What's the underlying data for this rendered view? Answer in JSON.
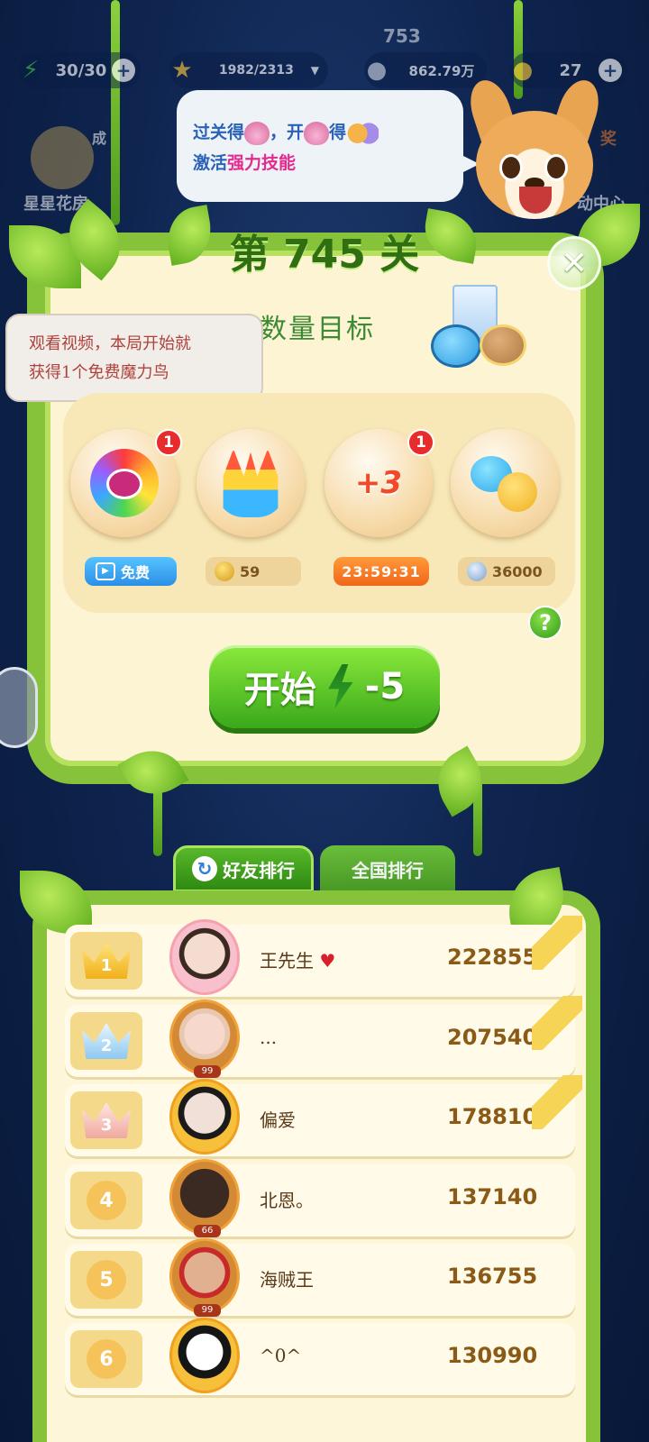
{
  "hud": {
    "energy": "30/30",
    "stars": "1982/2313",
    "coins": "862.79万",
    "gold": "27",
    "level_top": "753"
  },
  "background": {
    "left_label": "星星花房",
    "left_small": "成",
    "right_label": "动中心",
    "right_small": "奖"
  },
  "speech": {
    "line1_a": "过关得",
    "line1_b": "，开",
    "line1_c": "得",
    "line2_a": "激活",
    "line2_b": "强力技能"
  },
  "level": {
    "title": "第 745 关",
    "goal": "消除足够数量目标"
  },
  "tooltip": {
    "line1": "观看视频，本局开始就",
    "line2": "获得1个免费魔力鸟"
  },
  "boosters": [
    {
      "icon": "rainbow-bird",
      "badge": "1",
      "pill_text": "免费",
      "pill_type": "free"
    },
    {
      "icon": "firework-rocket",
      "badge": "",
      "pill_text": "59",
      "pill_type": "gold"
    },
    {
      "icon": "plus3-moves",
      "badge": "1",
      "pill_text": "23:59:31",
      "pill_type": "timer"
    },
    {
      "icon": "candy-chick",
      "badge": "",
      "pill_text": "36000",
      "pill_type": "coin"
    }
  ],
  "start_button": {
    "label": "开始",
    "cost": "-5"
  },
  "tabs": {
    "friends": "好友排行",
    "national": "全国排行"
  },
  "ranking": [
    {
      "rank": "1",
      "name": "王先生",
      "score": "222855",
      "level": ""
    },
    {
      "rank": "2",
      "name": "...",
      "score": "207540",
      "level": "99"
    },
    {
      "rank": "3",
      "name": "偏爱",
      "score": "178810",
      "level": ""
    },
    {
      "rank": "4",
      "name": "北恩。",
      "score": "137140",
      "level": "66"
    },
    {
      "rank": "5",
      "name": "海贼王",
      "score": "136755",
      "level": "99"
    },
    {
      "rank": "6",
      "name": "^0^",
      "score": "130990",
      "level": ""
    }
  ],
  "colors": {
    "vine_green": "#86c23a",
    "start_green": "#39a81a",
    "badge_red": "#e82b2b",
    "timer_orange": "#f07a1c"
  }
}
